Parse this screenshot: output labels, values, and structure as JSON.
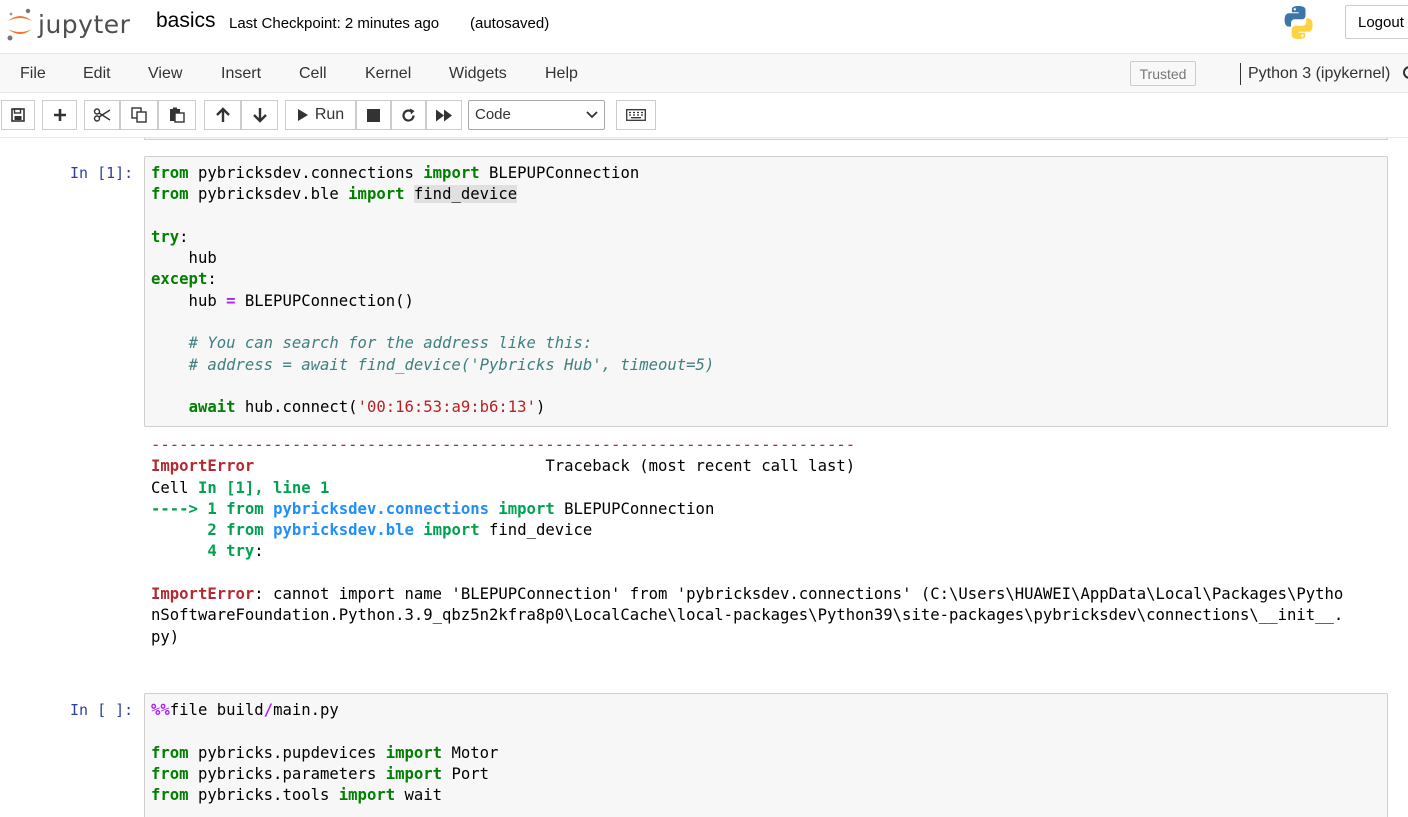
{
  "header": {
    "logo_text": "jupyter",
    "notebook_name": "basics",
    "checkpoint": "Last Checkpoint: 2 minutes ago",
    "autosave": "(autosaved)",
    "logout_label": "Logout"
  },
  "menubar": {
    "items": [
      "File",
      "Edit",
      "View",
      "Insert",
      "Cell",
      "Kernel",
      "Widgets",
      "Help"
    ],
    "trusted_label": "Trusted",
    "kernel_name": "Python 3 (ipykernel)"
  },
  "toolbar": {
    "run_label": "Run",
    "cell_type": "Code",
    "icons": [
      "save-icon",
      "plus-icon",
      "cut-icon",
      "copy-icon",
      "paste-icon",
      "arrow-up-icon",
      "arrow-down-icon",
      "play-icon",
      "stop-icon",
      "restart-icon",
      "fast-forward-icon",
      "keyboard-icon"
    ]
  },
  "colors": {
    "keyword": "#008000",
    "operator": "#aa22ff",
    "comment": "#408080",
    "string": "#ba2121",
    "prompt": "#303f9f",
    "error": "#b22b31"
  },
  "cells": [
    {
      "prompt": "In [1]:",
      "lines": [
        [
          [
            "kw",
            "from"
          ],
          [
            "t",
            " pybricksdev.connections "
          ],
          [
            "kw",
            "import"
          ],
          [
            "t",
            " BLEPUPConnection"
          ]
        ],
        [
          [
            "kw",
            "from"
          ],
          [
            "t",
            " pybricksdev.ble "
          ],
          [
            "kw",
            "import"
          ],
          [
            "t",
            " "
          ],
          [
            "hl",
            "find_device"
          ]
        ],
        [],
        [
          [
            "kw",
            "try"
          ],
          [
            "t",
            ":"
          ]
        ],
        [
          [
            "t",
            "    hub"
          ]
        ],
        [
          [
            "kw",
            "except"
          ],
          [
            "t",
            ":"
          ]
        ],
        [
          [
            "t",
            "    hub "
          ],
          [
            "op",
            "="
          ],
          [
            "t",
            " BLEPUPConnection()"
          ]
        ],
        [],
        [
          [
            "t",
            "    "
          ],
          [
            "cm",
            "# You can search for the address like this:"
          ]
        ],
        [
          [
            "t",
            "    "
          ],
          [
            "cm",
            "# address = await find_device('Pybricks Hub', timeout=5)"
          ]
        ],
        [],
        [
          [
            "t",
            "    "
          ],
          [
            "kw",
            "await"
          ],
          [
            "t",
            " hub.connect("
          ],
          [
            "st",
            "'00:16:53:a9:b6:13'"
          ],
          [
            "t",
            ")"
          ]
        ]
      ],
      "output": [
        [
          [
            "dash",
            "---------------------------------------------------------------------------"
          ]
        ],
        [
          [
            "red",
            "ImportError"
          ],
          [
            "t",
            "                               Traceback (most recent call last)"
          ]
        ],
        [
          [
            "t",
            "Cell "
          ],
          [
            "green",
            "In [1], line 1"
          ]
        ],
        [
          [
            "green",
            "----> 1 "
          ],
          [
            "green",
            "from"
          ],
          [
            "t",
            " "
          ],
          [
            "blue",
            "pybricksdev.connections"
          ],
          [
            "t",
            " "
          ],
          [
            "green",
            "import"
          ],
          [
            "t",
            " BLEPUPConnection"
          ]
        ],
        [
          [
            "t",
            "      "
          ],
          [
            "green",
            "2"
          ],
          [
            "t",
            " "
          ],
          [
            "green",
            "from"
          ],
          [
            "t",
            " "
          ],
          [
            "blue",
            "pybricksdev.ble"
          ],
          [
            "t",
            " "
          ],
          [
            "green",
            "import"
          ],
          [
            "t",
            " find_device"
          ]
        ],
        [
          [
            "t",
            "      "
          ],
          [
            "green",
            "4"
          ],
          [
            "t",
            " "
          ],
          [
            "green",
            "try"
          ],
          [
            "t",
            ":"
          ]
        ],
        [],
        [
          [
            "red",
            "ImportError"
          ],
          [
            "t",
            ": cannot import name 'BLEPUPConnection' from 'pybricksdev.connections' (C:\\Users\\HUAWEI\\AppData\\Local\\Packages\\Pytho"
          ]
        ],
        [
          [
            "t",
            "nSoftwareFoundation.Python.3.9_qbz5n2kfra8p0\\LocalCache\\local-packages\\Python39\\site-packages\\pybricksdev\\connections\\__init__."
          ]
        ],
        [
          [
            "t",
            "py)"
          ]
        ]
      ]
    },
    {
      "prompt": "In [ ]:",
      "lines": [
        [
          [
            "op",
            "%%"
          ],
          [
            "t",
            "file build"
          ],
          [
            "op",
            "/"
          ],
          [
            "t",
            "main.py"
          ]
        ],
        [],
        [
          [
            "kw",
            "from"
          ],
          [
            "t",
            " pybricks.pupdevices "
          ],
          [
            "kw",
            "import"
          ],
          [
            "t",
            " Motor"
          ]
        ],
        [
          [
            "kw",
            "from"
          ],
          [
            "t",
            " pybricks.parameters "
          ],
          [
            "kw",
            "import"
          ],
          [
            "t",
            " Port"
          ]
        ],
        [
          [
            "kw",
            "from"
          ],
          [
            "t",
            " pybricks.tools "
          ],
          [
            "kw",
            "import"
          ],
          [
            "t",
            " wait"
          ]
        ]
      ]
    }
  ]
}
